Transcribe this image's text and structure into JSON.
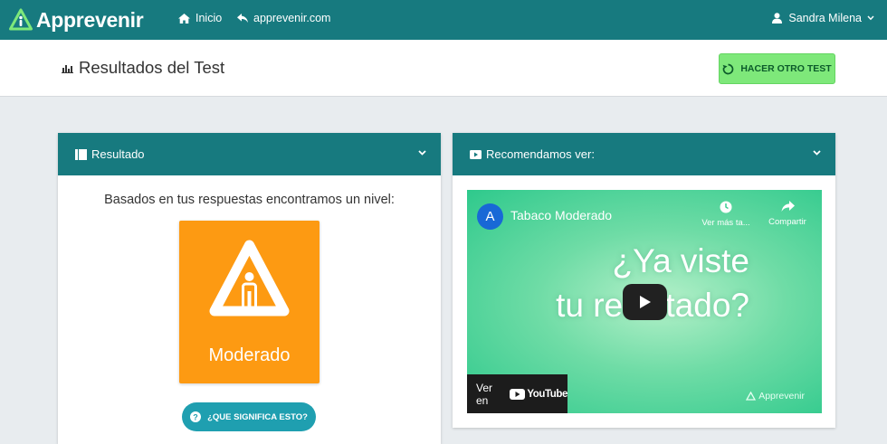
{
  "app": {
    "brand": "Apprevenir",
    "nav": [
      {
        "label": "Inicio",
        "icon": "home-icon"
      },
      {
        "label": "apprevenir.com",
        "icon": "reply-icon"
      }
    ],
    "user": {
      "name": "Sandra Milena",
      "icon": "user-icon"
    }
  },
  "header": {
    "title": "Resultados del Test",
    "title_icon": "bar-chart-icon",
    "retake_label": "HACER OTRO TEST",
    "retake_icon": "refresh-icon"
  },
  "result_card": {
    "title": "Resultado",
    "title_icon": "book-icon",
    "lead": "Basados en tus respuestas encontramos un nivel:",
    "level": "Moderado",
    "level_color": "#fd9a12",
    "meaning_label": "¿QUE SIGNIFICA ESTO?",
    "meaning_icon": "question-circle-icon"
  },
  "video_card": {
    "title": "Recomendamos ver:",
    "title_icon": "video-icon",
    "video": {
      "channel_initial": "A",
      "title": "Tabaco Moderado",
      "watch_later": "Ver más ta...",
      "share": "Compartir",
      "headline_line1": "¿Ya viste",
      "headline_line2": "tu resultado?",
      "watch_on": "Ver en",
      "platform": "YouTube",
      "watermark": "Apprevenir"
    }
  },
  "colors": {
    "primary": "#177a7f",
    "retake": "#7ee87a",
    "meaning_button": "#1f9fb0",
    "video_bg": "#6fdca6"
  }
}
